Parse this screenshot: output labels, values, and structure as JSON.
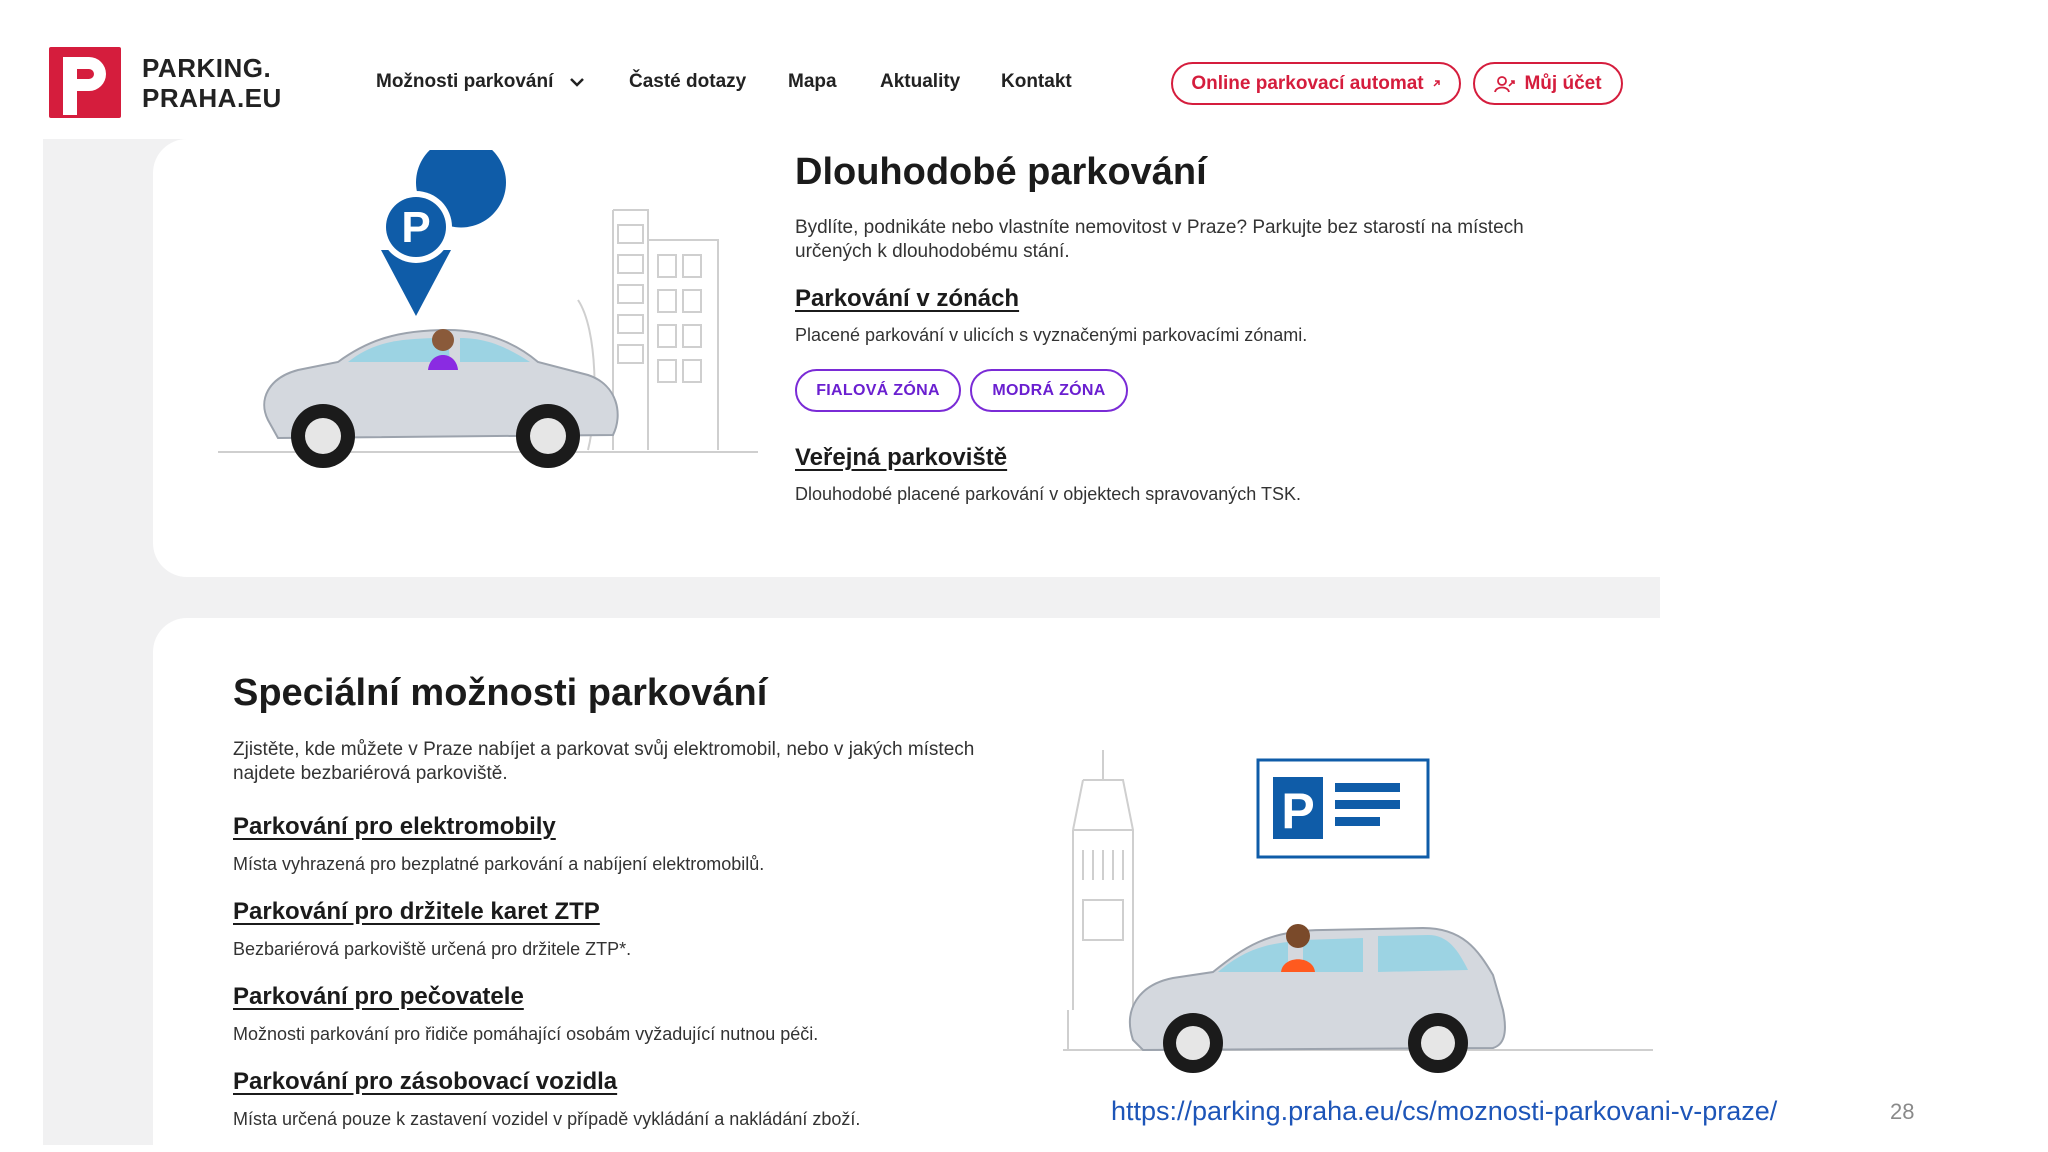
{
  "header": {
    "logo_letter": "P",
    "logo_line1": "PARKING.",
    "logo_line2": "PRAHA.EU",
    "nav": [
      "Možnosti parkování",
      "Časté dotazy",
      "Mapa",
      "Aktuality",
      "Kontakt"
    ],
    "online_button": "Online parkovací automat",
    "account_button": "Můj účet",
    "brand_color": "#d51d3d"
  },
  "long_term": {
    "title": "Dlouhodobé parkování",
    "intro_line1": "Bydlíte, podnikáte nebo vlastníte nemovitost v Praze? Parkujte bez starostí na místech",
    "intro_line2": "určených k dlouhodobému stání.",
    "zones_link": "Parkování v zónách",
    "zones_desc": "Placené parkování v ulicích s vyznačenými parkovacími zónami.",
    "tags": [
      "FIALOVÁ ZÓNA",
      "MODRÁ ZÓNA"
    ],
    "public_link": "Veřejná parkoviště",
    "public_desc": "Dlouhodobé placené parkování v objektech spravovaných TSK.",
    "illustration_sign_letter": "P"
  },
  "special": {
    "title": "Speciální možnosti parkování",
    "intro_line1": "Zjistěte, kde můžete v Praze nabíjet a parkovat svůj elektromobil, nebo v jakých místech",
    "intro_line2": "najdete bezbariérová parkoviště.",
    "items": [
      {
        "link": "Parkování pro elektromobily",
        "desc": "Místa vyhrazená pro bezplatné parkování a nabíjení elektromobilů."
      },
      {
        "link": "Parkování pro držitele karet ZTP",
        "desc": "Bezbariérová parkoviště určená pro držitele ZTP*."
      },
      {
        "link": "Parkování pro pečovatele",
        "desc": "Možnosti parkování pro řidiče pomáhající osobám vyžadující nutnou péči."
      },
      {
        "link": "Parkování pro zásobovací vozidla",
        "desc": "Místa určená pouze k zastavení vozidel v případě vykládání a nakládání zboží."
      }
    ],
    "illustration_sign_letter": "P"
  },
  "footer": {
    "url": "https://parking.praha.eu/cs/moznosti-parkovani-v-praze/",
    "page_number": "28"
  }
}
